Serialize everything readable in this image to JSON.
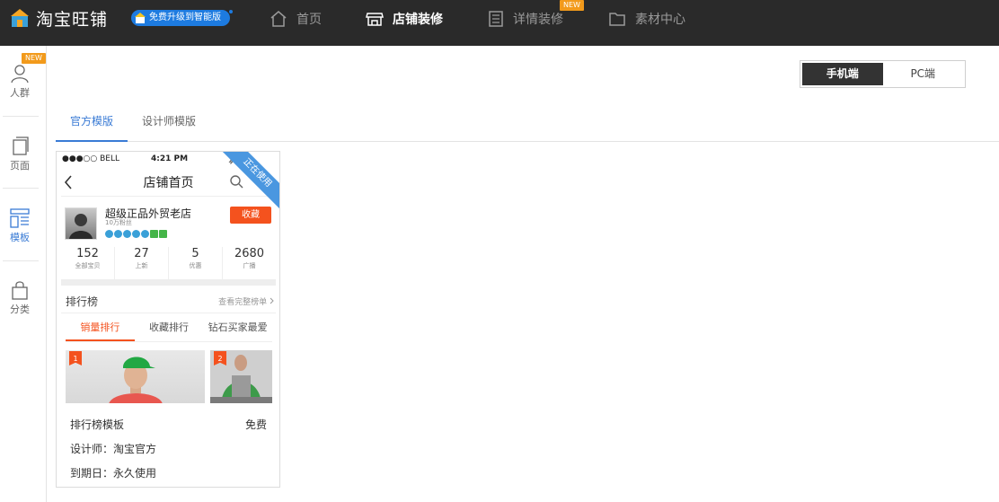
{
  "brand": {
    "name": "淘宝旺铺",
    "upgrade_label": "免费升级到智能版"
  },
  "nav": [
    {
      "label": "首页",
      "icon": "home-icon",
      "active": false
    },
    {
      "label": "店铺装修",
      "icon": "store-icon",
      "active": true
    },
    {
      "label": "详情装修",
      "icon": "document-icon",
      "active": false,
      "badge": "NEW"
    },
    {
      "label": "素材中心",
      "icon": "folder-icon",
      "active": false
    }
  ],
  "sidebar": [
    {
      "label": "人群",
      "icon": "person-icon",
      "badge": "NEW"
    },
    {
      "label": "页面",
      "icon": "page-icon"
    },
    {
      "label": "模板",
      "icon": "template-icon",
      "active": true
    },
    {
      "label": "分类",
      "icon": "bag-icon"
    }
  ],
  "device_toggle": {
    "mobile": "手机端",
    "pc": "PC端",
    "selected": "mobile"
  },
  "tabs": [
    {
      "label": "官方模版",
      "active": true
    },
    {
      "label": "设计师模版",
      "active": false
    }
  ],
  "template_card": {
    "ribbon": "正在使用",
    "phone": {
      "carrier": "●●●○○ BELL",
      "time": "4:21 PM",
      "title": "店铺首页",
      "shop_name": "超级正品外贸老店",
      "fans": "10万粉丝",
      "favorite_button": "收藏",
      "stats": [
        {
          "value": "152",
          "label": "全部宝贝"
        },
        {
          "value": "27",
          "label": "上新"
        },
        {
          "value": "5",
          "label": "优惠"
        },
        {
          "value": "2680",
          "label": "广播"
        }
      ],
      "rank_title": "排行榜",
      "rank_more": "查看完整榜单",
      "rank_tabs": [
        "销量排行",
        "收藏排行",
        "钻石买家最爱"
      ],
      "rank_badges": [
        "1",
        "2"
      ]
    },
    "name": "排行榜模板",
    "price": "免费",
    "designer_label": "设计师：",
    "designer": "淘宝官方",
    "expiry_label": "到期日：",
    "expiry": "永久使用"
  }
}
